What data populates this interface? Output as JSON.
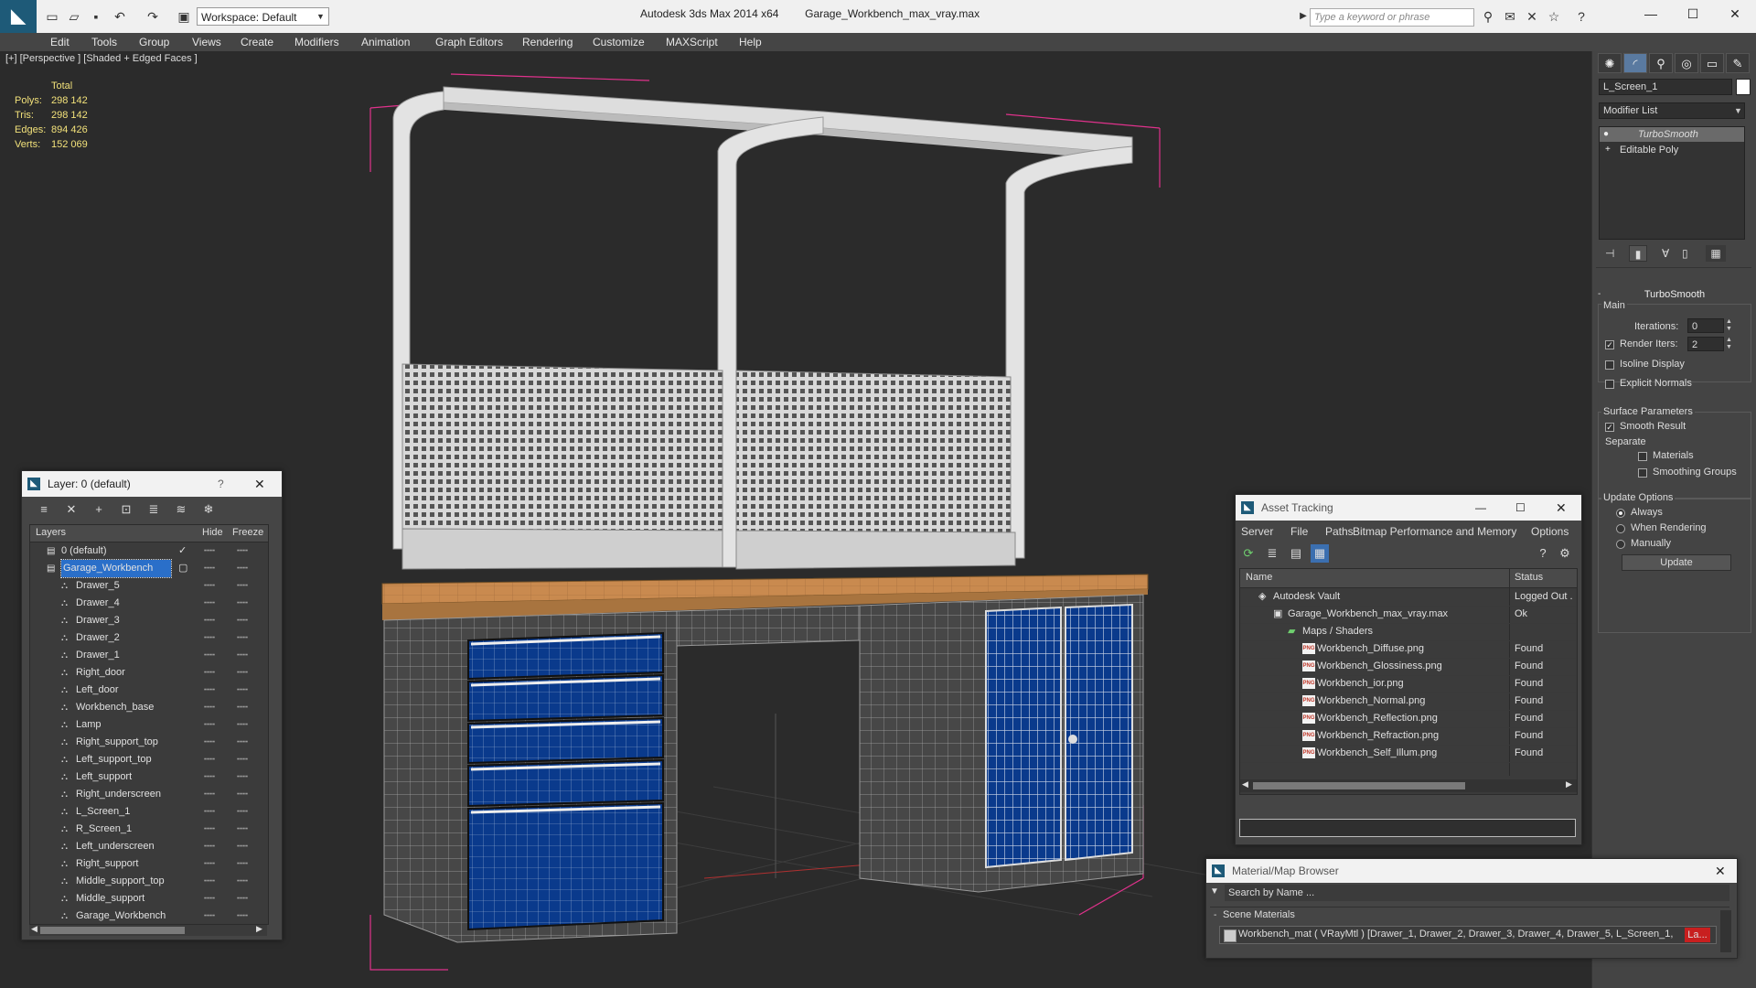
{
  "titlebar": {
    "workspace": "Workspace: Default",
    "app": "Autodesk 3ds Max  2014 x64",
    "file": "Garage_Workbench_max_vray.max",
    "search_placeholder": "Type a keyword or phrase"
  },
  "menu": [
    "Edit",
    "Tools",
    "Group",
    "Views",
    "Create",
    "Modifiers",
    "Animation",
    "Graph Editors",
    "Rendering",
    "Customize",
    "MAXScript",
    "Help"
  ],
  "viewport": {
    "label": "[+] [Perspective ] [Shaded + Edged Faces ]",
    "stats_header": "Total",
    "stats": [
      {
        "label": "Polys:",
        "value": "298 142"
      },
      {
        "label": "Tris:",
        "value": "298 142"
      },
      {
        "label": "Edges:",
        "value": "894 426"
      },
      {
        "label": "Verts:",
        "value": "152 069"
      }
    ]
  },
  "command_panel": {
    "object_name": "L_Screen_1",
    "modifier_list": "Modifier List",
    "stack": [
      "TurboSmooth",
      "Editable Poly"
    ],
    "rollout_title": "TurboSmooth",
    "main_label": "Main",
    "iterations_label": "Iterations:",
    "iterations_value": "0",
    "render_iters_label": "Render Iters:",
    "render_iters_value": "2",
    "isoline": "Isoline Display",
    "explicit_normals": "Explicit Normals",
    "surface_params": "Surface Parameters",
    "smooth_result": "Smooth Result",
    "separate": "Separate",
    "materials": "Materials",
    "smoothing_groups": "Smoothing Groups",
    "update_options": "Update Options",
    "always": "Always",
    "when_rendering": "When Rendering",
    "manually": "Manually",
    "update_button": "Update"
  },
  "layer_dialog": {
    "title": "Layer: 0 (default)",
    "help": "?",
    "col_layers": "Layers",
    "col_hide": "Hide",
    "col_freeze": "Freeze",
    "rows": [
      "0 (default)",
      "Garage_Workbench",
      "Drawer_5",
      "Drawer_4",
      "Drawer_3",
      "Drawer_2",
      "Drawer_1",
      "Right_door",
      "Left_door",
      "Workbench_base",
      "Lamp",
      "Right_support_top",
      "Left_support_top",
      "Left_support",
      "Right_underscreen",
      "L_Screen_1",
      "R_Screen_1",
      "Left_underscreen",
      "Right_support",
      "Middle_support_top",
      "Middle_support",
      "Garage_Workbench"
    ]
  },
  "asset_dialog": {
    "title": "Asset Tracking",
    "menu": [
      "Server",
      "File",
      "Paths",
      "Bitmap Performance and Memory",
      "Options"
    ],
    "col_name": "Name",
    "col_status": "Status",
    "rows": [
      {
        "name": "Autodesk Vault",
        "status": "Logged Out ."
      },
      {
        "name": "Garage_Workbench_max_vray.max",
        "status": "Ok"
      },
      {
        "name": "Maps / Shaders",
        "status": ""
      },
      {
        "name": "Workbench_Diffuse.png",
        "status": "Found"
      },
      {
        "name": "Workbench_Glossiness.png",
        "status": "Found"
      },
      {
        "name": "Workbench_ior.png",
        "status": "Found"
      },
      {
        "name": "Workbench_Normal.png",
        "status": "Found"
      },
      {
        "name": "Workbench_Reflection.png",
        "status": "Found"
      },
      {
        "name": "Workbench_Refraction.png",
        "status": "Found"
      },
      {
        "name": "Workbench_Self_Illum.png",
        "status": "Found"
      }
    ]
  },
  "material_dialog": {
    "title": "Material/Map Browser",
    "search_placeholder": "Search by Name ...",
    "section": "Scene Materials",
    "material": "Workbench_mat  ( VRayMtl )  [Drawer_1, Drawer_2, Drawer_3, Drawer_4, Drawer_5, L_Screen_1,",
    "material_tail": "La..."
  },
  "colors": {
    "viewport_bg": "#2b2b2b",
    "panel_bg": "#444444",
    "selected": "#2a6fc9",
    "stats": "#f2e17a",
    "drawer_blue": "#0a3a8c",
    "wood": "#c98a4f"
  }
}
